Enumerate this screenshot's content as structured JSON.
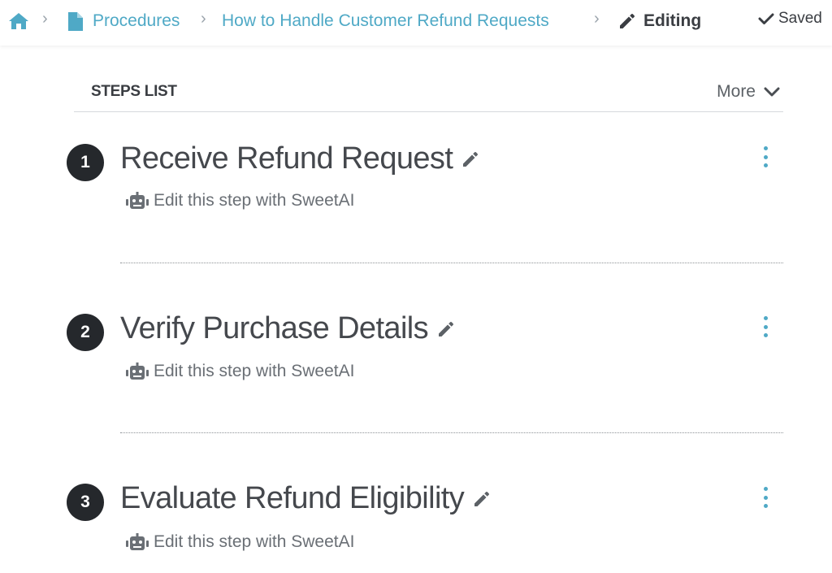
{
  "breadcrumb": {
    "home_icon": "home-icon",
    "doc_icon": "document-icon",
    "procedures_label": "Procedures",
    "procedure_title": "How to Handle Customer Refund Requests",
    "editing_label": "Editing",
    "separator": "›"
  },
  "status": {
    "saved_label": "Saved"
  },
  "steps_list": {
    "title": "STEPS LIST",
    "more_label": "More"
  },
  "steps": [
    {
      "number": "1",
      "title": "Receive Refund Request",
      "ai_label": "Edit this step with SweetAI"
    },
    {
      "number": "2",
      "title": "Verify Purchase Details",
      "ai_label": "Edit this step with SweetAI"
    },
    {
      "number": "3",
      "title": "Evaluate Refund Eligibility",
      "ai_label": "Edit this step with SweetAI"
    }
  ],
  "colors": {
    "accent": "#4fa9c6",
    "text_dark": "#3a3d42",
    "step_badge": "#25282c",
    "muted": "#6a6f75"
  }
}
